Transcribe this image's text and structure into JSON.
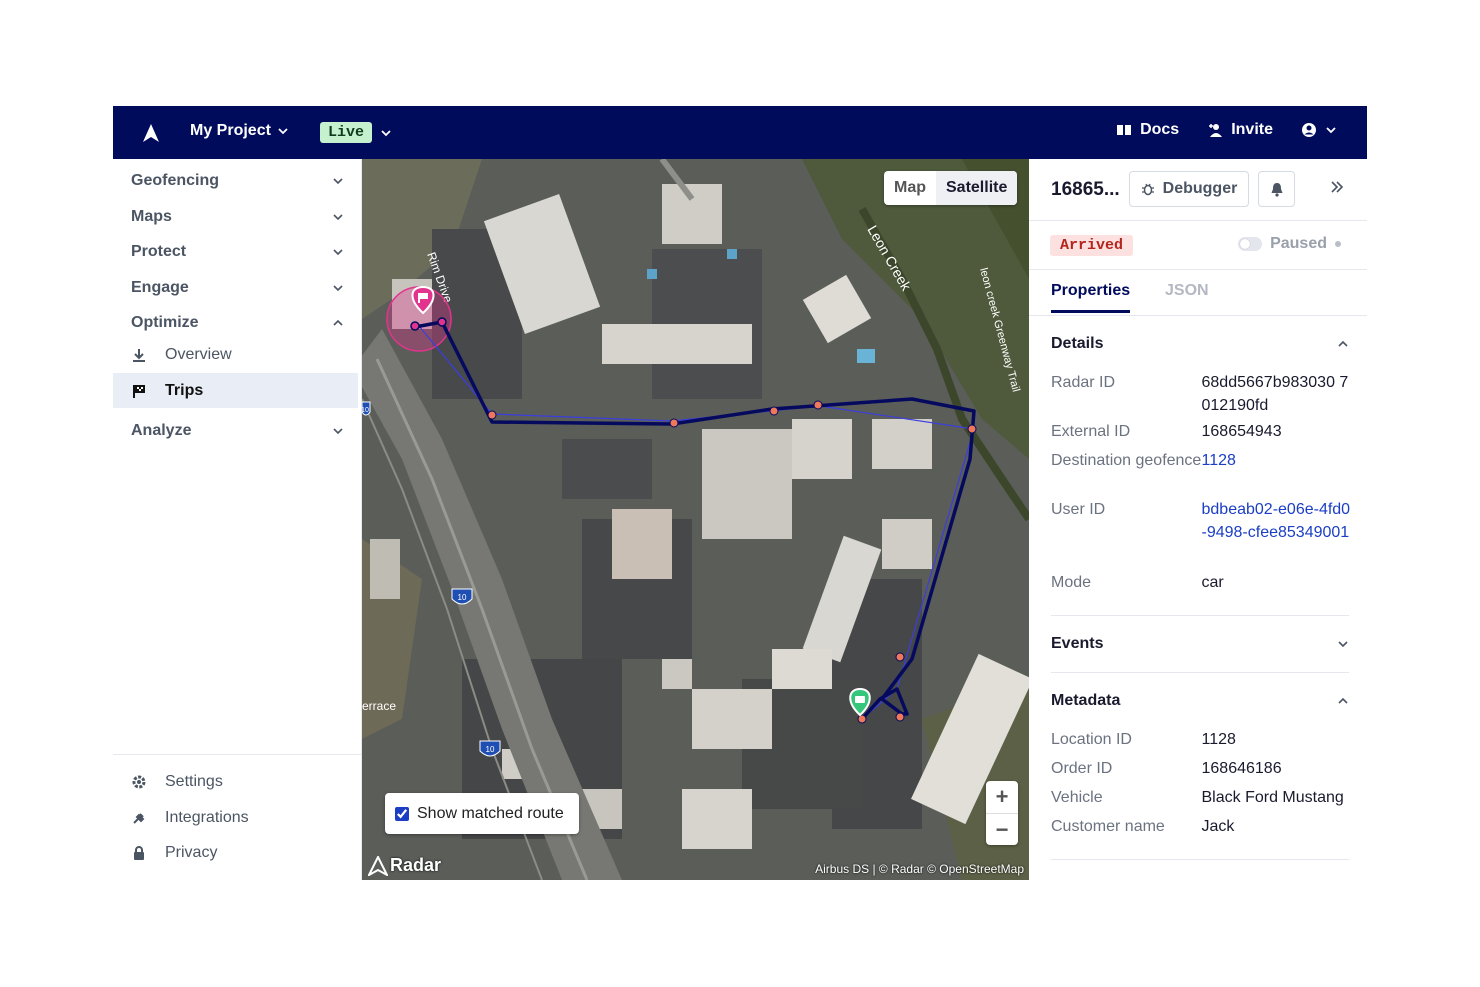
{
  "topbar": {
    "project": "My Project",
    "environment": "Live",
    "docs": "Docs",
    "invite": "Invite"
  },
  "sidebar": {
    "groups": [
      {
        "label": "Geofencing"
      },
      {
        "label": "Maps"
      },
      {
        "label": "Protect"
      },
      {
        "label": "Engage"
      },
      {
        "label": "Optimize"
      },
      {
        "label": "Analyze"
      }
    ],
    "optimize_items": [
      {
        "label": "Overview"
      },
      {
        "label": "Trips"
      }
    ],
    "bottom": [
      {
        "label": "Settings"
      },
      {
        "label": "Integrations"
      },
      {
        "label": "Privacy"
      }
    ]
  },
  "map": {
    "toggle_map": "Map",
    "toggle_satellite": "Satellite",
    "matched_route_label": "Show matched route",
    "zoom_in": "+",
    "zoom_out": "−",
    "attribution": "Airbus DS | © Radar © OpenStreetMap",
    "brand": "Radar",
    "labels": {
      "rim": "Rim Drive",
      "leon": "Leon Creek",
      "greenway": "leon creek Greenway Trail",
      "terrace": "errace",
      "shield_a": "10",
      "shield_b": "10",
      "shield_edge": "10"
    }
  },
  "panel": {
    "trip_id": "16865...",
    "debugger": "Debugger",
    "status": "Arrived",
    "paused": "Paused",
    "tabs": {
      "properties": "Properties",
      "json": "JSON"
    },
    "details": {
      "title": "Details",
      "radar_id_label": "Radar ID",
      "radar_id": "68dd5667b983030 7012190fd",
      "external_id_label": "External ID",
      "external_id": "168654943",
      "destination_label": "Destination geofence",
      "destination": "1128",
      "user_id_label": "User ID",
      "user_id": "bdbeab02-e06e-4fd0-9498-cfee85349001",
      "mode_label": "Mode",
      "mode": "car"
    },
    "events": {
      "title": "Events"
    },
    "metadata": {
      "title": "Metadata",
      "location_id_label": "Location ID",
      "location_id": "1128",
      "order_id_label": "Order ID",
      "order_id": "168646186",
      "vehicle_label": "Vehicle",
      "vehicle": "Black Ford Mustang",
      "customer_label": "Customer name",
      "customer": "Jack"
    }
  },
  "colors": {
    "brand_navy": "#010b5c",
    "live_green": "#c6f1cf",
    "arrived_red": "#b3261e",
    "link_blue": "#1b3ec4"
  }
}
